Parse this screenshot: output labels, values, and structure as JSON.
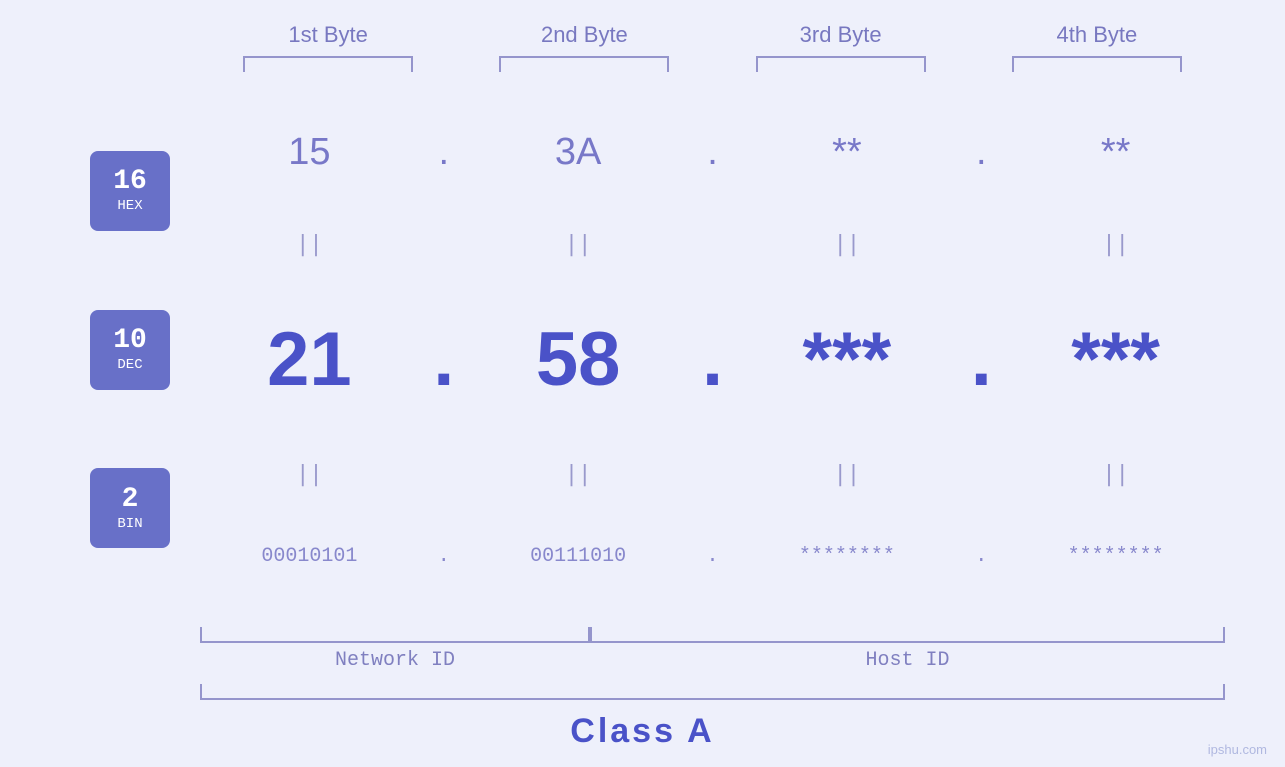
{
  "page": {
    "bg_color": "#eef0fb",
    "watermark": "ipshu.com"
  },
  "headers": {
    "byte1": "1st Byte",
    "byte2": "2nd Byte",
    "byte3": "3rd Byte",
    "byte4": "4th Byte"
  },
  "badges": {
    "hex": {
      "number": "16",
      "label": "HEX"
    },
    "dec": {
      "number": "10",
      "label": "DEC"
    },
    "bin": {
      "number": "2",
      "label": "BIN"
    }
  },
  "hex_row": {
    "v1": "15",
    "d1": ".",
    "v2": "3A",
    "d2": ".",
    "v3": "**",
    "d3": ".",
    "v4": "**"
  },
  "dec_row": {
    "v1": "21",
    "d1": ".",
    "v2": "58",
    "d2": ".",
    "v3": "***",
    "d3": ".",
    "v4": "***"
  },
  "bin_row": {
    "v1": "00010101",
    "d1": ".",
    "v2": "00111010",
    "d2": ".",
    "v3": "********",
    "d3": ".",
    "v4": "********"
  },
  "bottom_labels": {
    "network_id": "Network ID",
    "host_id": "Host ID",
    "class": "Class A"
  },
  "eq_symbol": "||"
}
